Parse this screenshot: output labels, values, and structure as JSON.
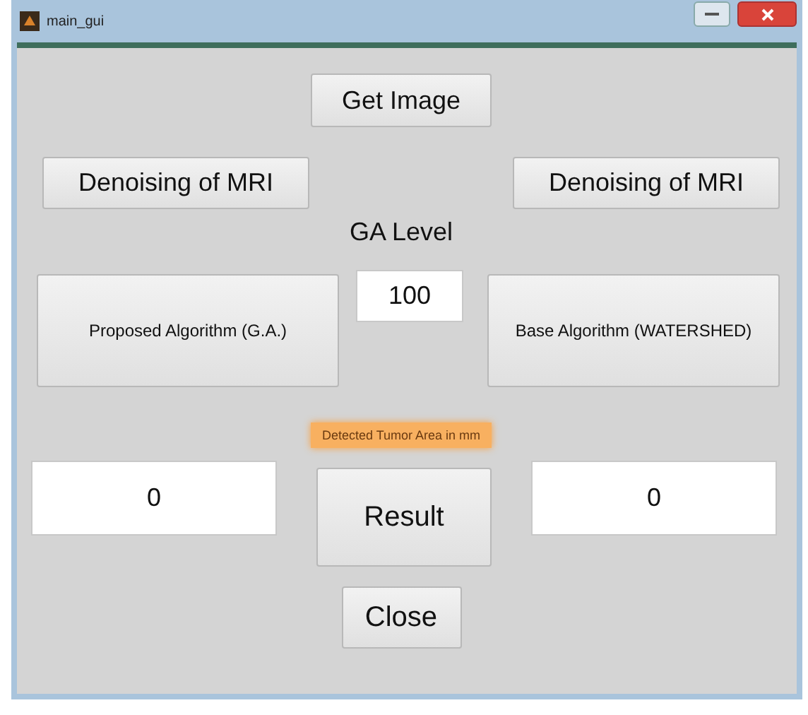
{
  "window": {
    "title": "main_gui"
  },
  "get_image_button": "Get Image",
  "denoise_buttons": [
    "Denoising of MRI",
    "Denoising of MRI"
  ],
  "ga_level": {
    "label": "GA Level",
    "value": "100"
  },
  "algorithm_buttons": [
    "Proposed Algorithm  (G.A.)",
    "Base Algorithm (WATERSHED)"
  ],
  "area_label": "Detected Tumor Area in mm",
  "result_fields": [
    "0",
    "0"
  ],
  "result_button": "Result",
  "close_button": "Close"
}
